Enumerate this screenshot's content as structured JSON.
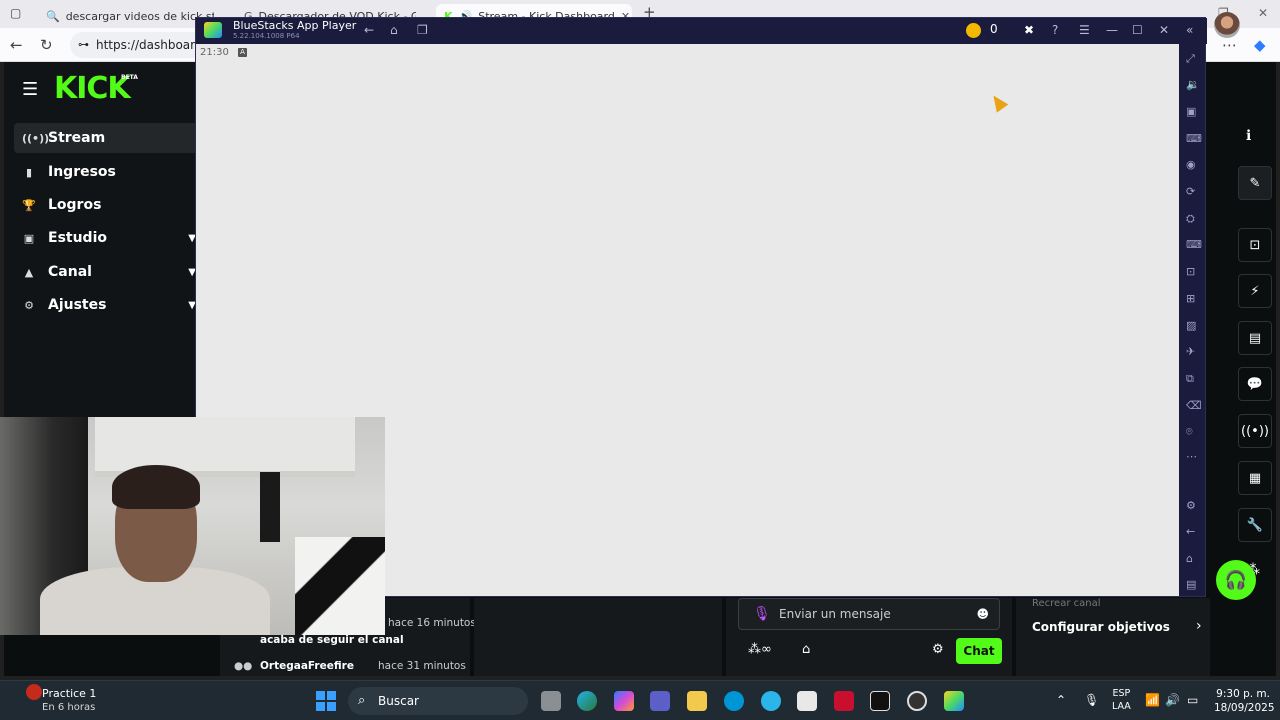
{
  "browser": {
    "tabs": [
      {
        "label": "descargar videos de kick streami"
      },
      {
        "label": "Descargador de VOD Kick - Gráfic"
      },
      {
        "label": "Stream - Kick Dashboard"
      }
    ],
    "new_tab": "+",
    "address": "https://dashboard.k"
  },
  "kick": {
    "logo": "KICK",
    "beta": "BETA",
    "nav": [
      {
        "label": "Stream",
        "icon": "stream-icon",
        "glyph": "((•))"
      },
      {
        "label": "Ingresos",
        "icon": "chart-icon",
        "glyph": "▮"
      },
      {
        "label": "Logros",
        "icon": "trophy-icon",
        "glyph": "🏆"
      },
      {
        "label": "Estudio",
        "icon": "studio-icon",
        "glyph": "▣"
      },
      {
        "label": "Canal",
        "icon": "channel-icon",
        "glyph": "▲"
      },
      {
        "label": "Ajustes",
        "icon": "gear-icon",
        "glyph": "⚙"
      }
    ],
    "activity": {
      "time1": "hace 16 minutos",
      "event1": "acaba de seguir el canal",
      "user2": "OrtegaaFreefire",
      "time2": "hace 31 minutos"
    },
    "chat": {
      "placeholder": "Enviar un mensaje",
      "button": "Chat"
    },
    "goals": {
      "faded": "Recrear canal",
      "title": "Configurar objetivos"
    }
  },
  "bluestacks": {
    "title": "BlueStacks App Player",
    "version": "5.22.104.1008  P64",
    "coins": "0",
    "time": "21:30",
    "badge": "A"
  },
  "taskbar": {
    "weather_title": "Practice 1",
    "weather_sub": "En 6 horas",
    "search": "Buscar",
    "lang1": "ESP",
    "lang2": "LAA",
    "time": "9:30 p. m.",
    "date": "18/09/2025"
  },
  "colors": {
    "kick_green": "#53fc18",
    "bluestacks_bg": "#1b1c3d",
    "taskbar_bg": "#1f2a33"
  }
}
